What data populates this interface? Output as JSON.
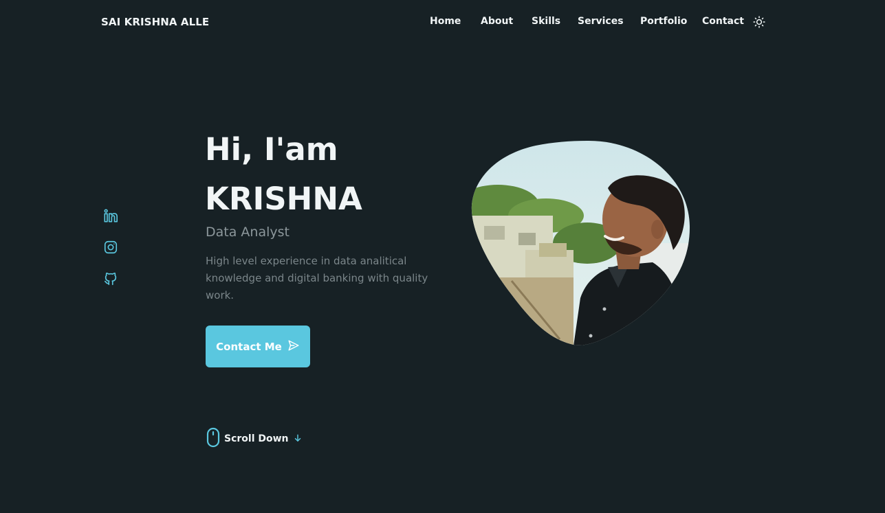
{
  "brand": "SAI KRISHNA ALLE",
  "nav": {
    "items": [
      {
        "label": "Home"
      },
      {
        "label": "About"
      },
      {
        "label": "Skills"
      },
      {
        "label": "Services"
      },
      {
        "label": "Portfolio"
      },
      {
        "label": "Contact"
      }
    ],
    "theme_icon": "sun-icon"
  },
  "social": [
    {
      "icon": "linkedin-icon"
    },
    {
      "icon": "instagram-icon"
    },
    {
      "icon": "github-icon"
    }
  ],
  "hero": {
    "greeting": "Hi, I'am",
    "name": "KRISHNA",
    "role": "Data Analyst",
    "description": "High level experience in data analitical knowledge and digital banking with quality work.",
    "cta_label": "Contact Me",
    "cta_icon": "send-icon"
  },
  "scroll": {
    "label": "Scroll Down",
    "mouse_icon": "mouse-icon",
    "arrow_icon": "arrow-down-icon"
  },
  "colors": {
    "background": "#172125",
    "accent": "#5ac7df",
    "text": "#f1f5f6",
    "muted": "#7b868a"
  }
}
